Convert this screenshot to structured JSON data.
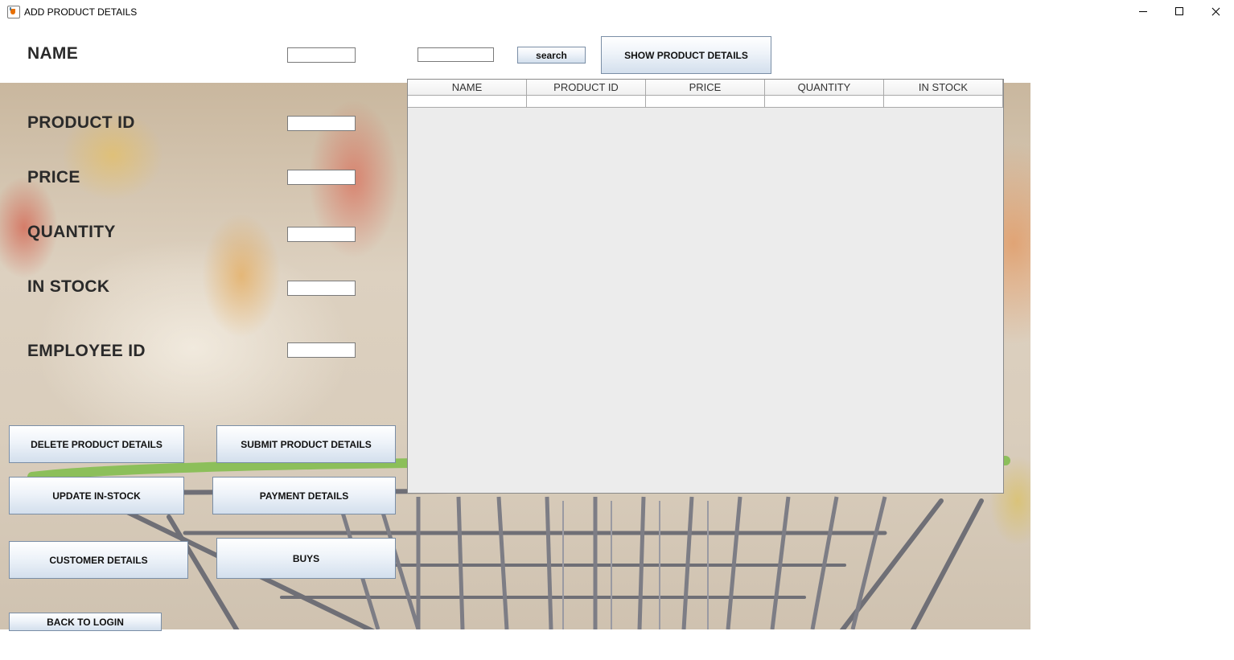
{
  "window": {
    "title": "ADD PRODUCT DETAILS",
    "icon": "java-cup-icon"
  },
  "form": {
    "name_label": "NAME",
    "product_id_label": "PRODUCT ID",
    "price_label": "PRICE",
    "quantity_label": "QUANTITY",
    "in_stock_label": "IN STOCK",
    "employee_id_label": "EMPLOYEE ID",
    "name_value": "",
    "product_id_value": "",
    "price_value": "",
    "quantity_value": "",
    "in_stock_value": "",
    "employee_id_value": ""
  },
  "search": {
    "query": "",
    "button_label": "search"
  },
  "buttons": {
    "show_product_details": "SHOW PRODUCT DETAILS",
    "delete_product_details": "DELETE PRODUCT DETAILS",
    "submit_product_details": "SUBMIT PRODUCT DETAILS",
    "update_in_stock": "UPDATE IN-STOCK",
    "payment_details": "PAYMENT DETAILS",
    "customer_details": "CUSTOMER DETAILS",
    "buys": "BUYS",
    "back_to_login": "BACK TO LOGIN"
  },
  "table": {
    "columns": [
      "NAME",
      "PRODUCT ID",
      "PRICE",
      "QUANTITY",
      "IN STOCK"
    ],
    "rows": [
      [
        "",
        "",
        "",
        "",
        ""
      ]
    ]
  }
}
